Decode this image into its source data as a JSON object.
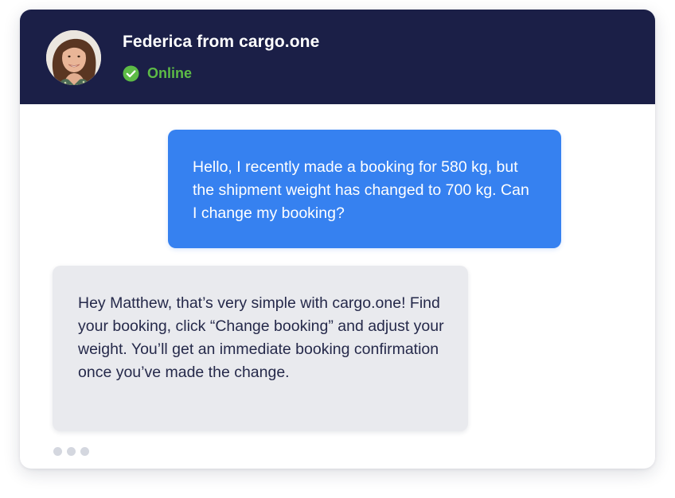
{
  "header": {
    "agent_name": "Federica from cargo.one",
    "status_label": "Online",
    "status_icon": "check-circle-icon",
    "background_color": "#1b1f47",
    "status_color": "#5dbb46"
  },
  "messages": [
    {
      "sender": "user",
      "text": "Hello, I recently made a booking for 580 kg, but the shipment weight has changed to 700 kg. Can I change my booking?",
      "color": "#3681f0"
    },
    {
      "sender": "agent",
      "text": "Hey Matthew, that’s very simple with cargo.one! Find your booking, click “Change booking” and adjust your weight. You’ll get an immediate booking confirmation once you’ve made the change.",
      "color": "#e9eaee"
    }
  ],
  "typing_indicator": {
    "icon": "typing-dots-icon"
  }
}
